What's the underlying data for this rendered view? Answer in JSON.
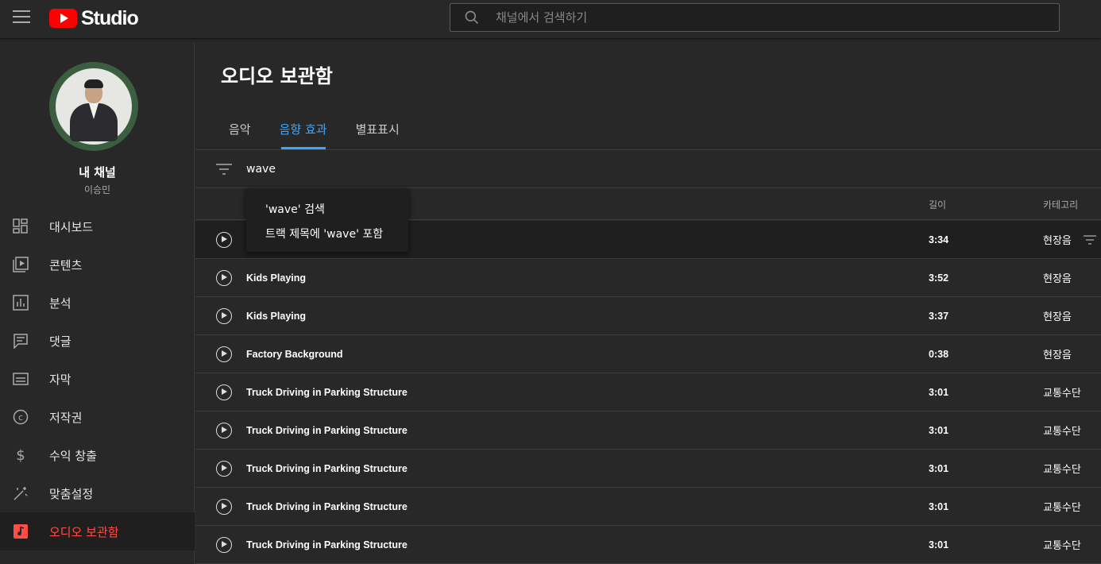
{
  "header": {
    "logo_text": "Studio",
    "search_placeholder": "채널에서 검색하기"
  },
  "sidebar": {
    "channel_name": "내 채널",
    "channel_owner": "이승민",
    "items": [
      {
        "label": "대시보드",
        "icon": "dashboard-icon"
      },
      {
        "label": "콘텐츠",
        "icon": "content-icon"
      },
      {
        "label": "분석",
        "icon": "analytics-icon"
      },
      {
        "label": "댓글",
        "icon": "comments-icon"
      },
      {
        "label": "자막",
        "icon": "subtitles-icon"
      },
      {
        "label": "저작권",
        "icon": "copyright-icon"
      },
      {
        "label": "수익 창출",
        "icon": "dollar-icon"
      },
      {
        "label": "맞춤설정",
        "icon": "magic-wand-icon"
      },
      {
        "label": "오디오 보관함",
        "icon": "audio-library-icon",
        "active": true
      }
    ]
  },
  "main": {
    "title": "오디오 보관함",
    "tabs": [
      {
        "label": "음악"
      },
      {
        "label": "음향 효과",
        "active": true
      },
      {
        "label": "별표표시"
      }
    ],
    "filter_value": "wave",
    "columns": {
      "length": "길이",
      "category": "카테고리"
    },
    "rows": [
      {
        "title": "",
        "length": "3:34",
        "category": "현장음"
      },
      {
        "title": "Kids Playing",
        "length": "3:52",
        "category": "현장음"
      },
      {
        "title": "Kids Playing",
        "length": "3:37",
        "category": "현장음"
      },
      {
        "title": "Factory Background",
        "length": "0:38",
        "category": "현장음"
      },
      {
        "title": "Truck Driving in Parking Structure",
        "length": "3:01",
        "category": "교통수단"
      },
      {
        "title": "Truck Driving in Parking Structure",
        "length": "3:01",
        "category": "교통수단"
      },
      {
        "title": "Truck Driving in Parking Structure",
        "length": "3:01",
        "category": "교통수단"
      },
      {
        "title": "Truck Driving in Parking Structure",
        "length": "3:01",
        "category": "교통수단"
      },
      {
        "title": "Truck Driving in Parking Structure",
        "length": "3:01",
        "category": "교통수단"
      }
    ],
    "dropdown": {
      "option1": "'wave' 검색",
      "option2": "트랙 제목에 'wave' 포함"
    }
  },
  "colors": {
    "accent": "#3ea6ff",
    "brand_red": "#ff0000",
    "active_nav": "#ff4e45",
    "background": "#282828"
  }
}
